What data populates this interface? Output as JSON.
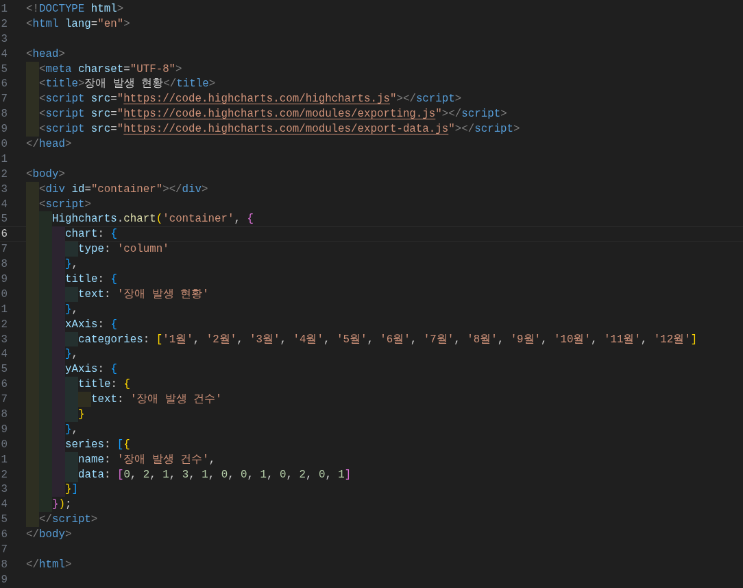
{
  "editor": {
    "lines": [
      {
        "number": "1",
        "current": false,
        "tokens": [
          {
            "kind": "punct",
            "text": "<!"
          },
          {
            "kind": "tag",
            "text": "DOCTYPE"
          },
          {
            "kind": "attr",
            "text": " html"
          },
          {
            "kind": "punct",
            "text": ">"
          }
        ]
      },
      {
        "number": "2",
        "current": false,
        "tokens": [
          {
            "kind": "punct",
            "text": "<"
          },
          {
            "kind": "tag",
            "text": "html"
          },
          {
            "kind": "attr",
            "text": " lang"
          },
          {
            "kind": "text",
            "text": "="
          },
          {
            "kind": "string",
            "text": "\"en\""
          },
          {
            "kind": "punct",
            "text": ">"
          }
        ]
      },
      {
        "number": "3",
        "current": false
      },
      {
        "number": "4",
        "current": false,
        "tokens": [
          {
            "kind": "punct",
            "text": "<"
          },
          {
            "kind": "tag",
            "text": "head"
          },
          {
            "kind": "punct",
            "text": ">"
          }
        ]
      },
      {
        "number": "5",
        "current": false,
        "guides": [
          {
            "color": "#2e2f22"
          }
        ],
        "tokens": [
          {
            "kind": "punct",
            "text": "<"
          },
          {
            "kind": "tag",
            "text": "meta"
          },
          {
            "kind": "attr",
            "text": " charset"
          },
          {
            "kind": "text",
            "text": "="
          },
          {
            "kind": "string",
            "text": "\"UTF-8\""
          },
          {
            "kind": "punct",
            "text": ">"
          }
        ]
      },
      {
        "number": "6",
        "current": false,
        "guides": [
          {
            "color": "#2e2f22"
          }
        ],
        "tokens": [
          {
            "kind": "punct",
            "text": "<"
          },
          {
            "kind": "tag",
            "text": "title"
          },
          {
            "kind": "punct",
            "text": ">"
          },
          {
            "kind": "text",
            "text": "장애 발생 현황"
          },
          {
            "kind": "punct",
            "text": "</"
          },
          {
            "kind": "tag",
            "text": "title"
          },
          {
            "kind": "punct",
            "text": ">"
          }
        ]
      },
      {
        "number": "7",
        "current": false,
        "guides": [
          {
            "color": "#2e2f22"
          }
        ],
        "tokens": [
          {
            "kind": "punct",
            "text": "<"
          },
          {
            "kind": "tag",
            "text": "script"
          },
          {
            "kind": "attr",
            "text": " src"
          },
          {
            "kind": "text",
            "text": "="
          },
          {
            "kind": "string",
            "text": "\""
          },
          {
            "kind": "link",
            "text": "https://code.highcharts.com/highcharts.js"
          },
          {
            "kind": "string",
            "text": "\""
          },
          {
            "kind": "punct",
            "text": "></"
          },
          {
            "kind": "tag",
            "text": "script"
          },
          {
            "kind": "punct",
            "text": ">"
          }
        ]
      },
      {
        "number": "8",
        "current": false,
        "guides": [
          {
            "color": "#2e2f22"
          }
        ],
        "tokens": [
          {
            "kind": "punct",
            "text": "<"
          },
          {
            "kind": "tag",
            "text": "script"
          },
          {
            "kind": "attr",
            "text": " src"
          },
          {
            "kind": "text",
            "text": "="
          },
          {
            "kind": "string",
            "text": "\""
          },
          {
            "kind": "link",
            "text": "https://code.highcharts.com/modules/exporting.js"
          },
          {
            "kind": "string",
            "text": "\""
          },
          {
            "kind": "punct",
            "text": "></"
          },
          {
            "kind": "tag",
            "text": "script"
          },
          {
            "kind": "punct",
            "text": ">"
          }
        ]
      },
      {
        "number": "9",
        "current": false,
        "guides": [
          {
            "color": "#2e2f22"
          }
        ],
        "tokens": [
          {
            "kind": "punct",
            "text": "<"
          },
          {
            "kind": "tag",
            "text": "script"
          },
          {
            "kind": "attr",
            "text": " src"
          },
          {
            "kind": "text",
            "text": "="
          },
          {
            "kind": "string",
            "text": "\""
          },
          {
            "kind": "link",
            "text": "https://code.highcharts.com/modules/export-data.js"
          },
          {
            "kind": "string",
            "text": "\""
          },
          {
            "kind": "punct",
            "text": "></"
          },
          {
            "kind": "tag",
            "text": "script"
          },
          {
            "kind": "punct",
            "text": ">"
          }
        ]
      },
      {
        "number": "0",
        "current": false,
        "tokens": [
          {
            "kind": "punct",
            "text": "</"
          },
          {
            "kind": "tag",
            "text": "head"
          },
          {
            "kind": "punct",
            "text": ">"
          }
        ]
      },
      {
        "number": "1",
        "current": false
      },
      {
        "number": "2",
        "current": false,
        "tokens": [
          {
            "kind": "punct",
            "text": "<"
          },
          {
            "kind": "tag",
            "text": "body"
          },
          {
            "kind": "punct",
            "text": ">"
          }
        ]
      },
      {
        "number": "3",
        "current": false,
        "guides": [
          {
            "color": "#2e2f22"
          }
        ],
        "tokens": [
          {
            "kind": "punct",
            "text": "<"
          },
          {
            "kind": "tag",
            "text": "div"
          },
          {
            "kind": "attr",
            "text": " id"
          },
          {
            "kind": "text",
            "text": "="
          },
          {
            "kind": "string",
            "text": "\"container\""
          },
          {
            "kind": "punct",
            "text": "></"
          },
          {
            "kind": "tag",
            "text": "div"
          },
          {
            "kind": "punct",
            "text": ">"
          }
        ]
      },
      {
        "number": "4",
        "current": false,
        "guides": [
          {
            "color": "#2e2f22"
          }
        ],
        "tokens": [
          {
            "kind": "punct",
            "text": "<"
          },
          {
            "kind": "tag",
            "text": "script"
          },
          {
            "kind": "punct",
            "text": ">"
          }
        ]
      },
      {
        "number": "5",
        "current": false,
        "guides": [
          {
            "color": "#2e2f22"
          },
          {
            "color": "#232d25"
          }
        ],
        "tokens": [
          {
            "kind": "var",
            "text": "Highcharts"
          },
          {
            "kind": "text",
            "text": "."
          },
          {
            "kind": "fn",
            "text": "chart"
          },
          {
            "kind": "bracket1",
            "text": "("
          },
          {
            "kind": "string",
            "text": "'container'"
          },
          {
            "kind": "text",
            "text": ", "
          },
          {
            "kind": "bracket2",
            "text": "{"
          }
        ]
      },
      {
        "number": "6",
        "current": true,
        "guides": [
          {
            "color": "#2e2f22"
          },
          {
            "color": "#232d25"
          },
          {
            "color": "#2c2430"
          }
        ],
        "tokens": [
          {
            "kind": "var",
            "text": "chart"
          },
          {
            "kind": "text",
            "text": ": "
          },
          {
            "kind": "bracket3",
            "text": "{"
          }
        ]
      },
      {
        "number": "7",
        "current": false,
        "guides": [
          {
            "color": "#2e2f22"
          },
          {
            "color": "#232d25"
          },
          {
            "color": "#2c2430"
          },
          {
            "color": "#24302f"
          }
        ],
        "tokens": [
          {
            "kind": "var",
            "text": "type"
          },
          {
            "kind": "text",
            "text": ": "
          },
          {
            "kind": "string",
            "text": "'column'"
          }
        ]
      },
      {
        "number": "8",
        "current": false,
        "guides": [
          {
            "color": "#2e2f22"
          },
          {
            "color": "#232d25"
          },
          {
            "color": "#2c2430"
          }
        ],
        "tokens": [
          {
            "kind": "bracket3",
            "text": "}"
          },
          {
            "kind": "text",
            "text": ","
          }
        ]
      },
      {
        "number": "9",
        "current": false,
        "guides": [
          {
            "color": "#2e2f22"
          },
          {
            "color": "#232d25"
          },
          {
            "color": "#2c2430"
          }
        ],
        "tokens": [
          {
            "kind": "var",
            "text": "title"
          },
          {
            "kind": "text",
            "text": ": "
          },
          {
            "kind": "bracket3",
            "text": "{"
          }
        ]
      },
      {
        "number": "0",
        "current": false,
        "guides": [
          {
            "color": "#2e2f22"
          },
          {
            "color": "#232d25"
          },
          {
            "color": "#2c2430"
          },
          {
            "color": "#24302f"
          }
        ],
        "tokens": [
          {
            "kind": "var",
            "text": "text"
          },
          {
            "kind": "text",
            "text": ": "
          },
          {
            "kind": "string",
            "text": "'장애 발생 현황'"
          }
        ]
      },
      {
        "number": "1",
        "current": false,
        "guides": [
          {
            "color": "#2e2f22"
          },
          {
            "color": "#232d25"
          },
          {
            "color": "#2c2430"
          }
        ],
        "tokens": [
          {
            "kind": "bracket3",
            "text": "}"
          },
          {
            "kind": "text",
            "text": ","
          }
        ]
      },
      {
        "number": "2",
        "current": false,
        "guides": [
          {
            "color": "#2e2f22"
          },
          {
            "color": "#232d25"
          },
          {
            "color": "#2c2430"
          }
        ],
        "tokens": [
          {
            "kind": "var",
            "text": "xAxis"
          },
          {
            "kind": "text",
            "text": ": "
          },
          {
            "kind": "bracket3",
            "text": "{"
          }
        ]
      },
      {
        "number": "3",
        "current": false,
        "guides": [
          {
            "color": "#2e2f22"
          },
          {
            "color": "#232d25"
          },
          {
            "color": "#2c2430"
          },
          {
            "color": "#24302f"
          }
        ],
        "tokens": [
          {
            "kind": "var",
            "text": "categories"
          },
          {
            "kind": "text",
            "text": ": "
          },
          {
            "kind": "bracket1",
            "text": "["
          },
          {
            "kind": "string",
            "text": "'1월'"
          },
          {
            "kind": "text",
            "text": ", "
          },
          {
            "kind": "string",
            "text": "'2월'"
          },
          {
            "kind": "text",
            "text": ", "
          },
          {
            "kind": "string",
            "text": "'3월'"
          },
          {
            "kind": "text",
            "text": ", "
          },
          {
            "kind": "string",
            "text": "'4월'"
          },
          {
            "kind": "text",
            "text": ", "
          },
          {
            "kind": "string",
            "text": "'5월'"
          },
          {
            "kind": "text",
            "text": ", "
          },
          {
            "kind": "string",
            "text": "'6월'"
          },
          {
            "kind": "text",
            "text": ", "
          },
          {
            "kind": "string",
            "text": "'7월'"
          },
          {
            "kind": "text",
            "text": ", "
          },
          {
            "kind": "string",
            "text": "'8월'"
          },
          {
            "kind": "text",
            "text": ", "
          },
          {
            "kind": "string",
            "text": "'9월'"
          },
          {
            "kind": "text",
            "text": ", "
          },
          {
            "kind": "string",
            "text": "'10월'"
          },
          {
            "kind": "text",
            "text": ", "
          },
          {
            "kind": "string",
            "text": "'11월'"
          },
          {
            "kind": "text",
            "text": ", "
          },
          {
            "kind": "string",
            "text": "'12월'"
          },
          {
            "kind": "bracket1",
            "text": "]"
          }
        ]
      },
      {
        "number": "4",
        "current": false,
        "guides": [
          {
            "color": "#2e2f22"
          },
          {
            "color": "#232d25"
          },
          {
            "color": "#2c2430"
          }
        ],
        "tokens": [
          {
            "kind": "bracket3",
            "text": "}"
          },
          {
            "kind": "text",
            "text": ","
          }
        ]
      },
      {
        "number": "5",
        "current": false,
        "guides": [
          {
            "color": "#2e2f22"
          },
          {
            "color": "#232d25"
          },
          {
            "color": "#2c2430"
          }
        ],
        "tokens": [
          {
            "kind": "var",
            "text": "yAxis"
          },
          {
            "kind": "text",
            "text": ": "
          },
          {
            "kind": "bracket3",
            "text": "{"
          }
        ]
      },
      {
        "number": "6",
        "current": false,
        "guides": [
          {
            "color": "#2e2f22"
          },
          {
            "color": "#232d25"
          },
          {
            "color": "#2c2430"
          },
          {
            "color": "#24302f"
          }
        ],
        "tokens": [
          {
            "kind": "var",
            "text": "title"
          },
          {
            "kind": "text",
            "text": ": "
          },
          {
            "kind": "bracket1",
            "text": "{"
          }
        ]
      },
      {
        "number": "7",
        "current": false,
        "guides": [
          {
            "color": "#2e2f22"
          },
          {
            "color": "#232d25"
          },
          {
            "color": "#2c2430"
          },
          {
            "color": "#24302f"
          },
          {
            "color": "#2f2e20"
          }
        ],
        "tokens": [
          {
            "kind": "var",
            "text": "text"
          },
          {
            "kind": "text",
            "text": ": "
          },
          {
            "kind": "string",
            "text": "'장애 발생 건수'"
          }
        ]
      },
      {
        "number": "8",
        "current": false,
        "guides": [
          {
            "color": "#2e2f22"
          },
          {
            "color": "#232d25"
          },
          {
            "color": "#2c2430"
          },
          {
            "color": "#24302f"
          }
        ],
        "tokens": [
          {
            "kind": "bracket1",
            "text": "}"
          }
        ]
      },
      {
        "number": "9",
        "current": false,
        "guides": [
          {
            "color": "#2e2f22"
          },
          {
            "color": "#232d25"
          },
          {
            "color": "#2c2430"
          }
        ],
        "tokens": [
          {
            "kind": "bracket3",
            "text": "}"
          },
          {
            "kind": "text",
            "text": ","
          }
        ]
      },
      {
        "number": "0",
        "current": false,
        "guides": [
          {
            "color": "#2e2f22"
          },
          {
            "color": "#232d25"
          },
          {
            "color": "#2c2430"
          }
        ],
        "tokens": [
          {
            "kind": "var",
            "text": "series"
          },
          {
            "kind": "text",
            "text": ": "
          },
          {
            "kind": "bracket3",
            "text": "["
          },
          {
            "kind": "bracket1",
            "text": "{"
          }
        ]
      },
      {
        "number": "1",
        "current": false,
        "guides": [
          {
            "color": "#2e2f22"
          },
          {
            "color": "#232d25"
          },
          {
            "color": "#2c2430"
          },
          {
            "color": "#24302f"
          }
        ],
        "tokens": [
          {
            "kind": "var",
            "text": "name"
          },
          {
            "kind": "text",
            "text": ": "
          },
          {
            "kind": "string",
            "text": "'장애 발생 건수'"
          },
          {
            "kind": "text",
            "text": ","
          }
        ]
      },
      {
        "number": "2",
        "current": false,
        "guides": [
          {
            "color": "#2e2f22"
          },
          {
            "color": "#232d25"
          },
          {
            "color": "#2c2430"
          },
          {
            "color": "#24302f"
          }
        ],
        "tokens": [
          {
            "kind": "var",
            "text": "data"
          },
          {
            "kind": "text",
            "text": ": "
          },
          {
            "kind": "bracket2",
            "text": "["
          },
          {
            "kind": "number",
            "text": "0"
          },
          {
            "kind": "text",
            "text": ", "
          },
          {
            "kind": "number",
            "text": "2"
          },
          {
            "kind": "text",
            "text": ", "
          },
          {
            "kind": "number",
            "text": "1"
          },
          {
            "kind": "text",
            "text": ", "
          },
          {
            "kind": "number",
            "text": "3"
          },
          {
            "kind": "text",
            "text": ", "
          },
          {
            "kind": "number",
            "text": "1"
          },
          {
            "kind": "text",
            "text": ", "
          },
          {
            "kind": "number",
            "text": "0"
          },
          {
            "kind": "text",
            "text": ", "
          },
          {
            "kind": "number",
            "text": "0"
          },
          {
            "kind": "text",
            "text": ", "
          },
          {
            "kind": "number",
            "text": "1"
          },
          {
            "kind": "text",
            "text": ", "
          },
          {
            "kind": "number",
            "text": "0"
          },
          {
            "kind": "text",
            "text": ", "
          },
          {
            "kind": "number",
            "text": "2"
          },
          {
            "kind": "text",
            "text": ", "
          },
          {
            "kind": "number",
            "text": "0"
          },
          {
            "kind": "text",
            "text": ", "
          },
          {
            "kind": "number",
            "text": "1"
          },
          {
            "kind": "bracket2",
            "text": "]"
          }
        ]
      },
      {
        "number": "3",
        "current": false,
        "guides": [
          {
            "color": "#2e2f22"
          },
          {
            "color": "#232d25"
          },
          {
            "color": "#2c2430"
          }
        ],
        "tokens": [
          {
            "kind": "bracket1",
            "text": "}"
          },
          {
            "kind": "bracket3",
            "text": "]"
          }
        ]
      },
      {
        "number": "4",
        "current": false,
        "guides": [
          {
            "color": "#2e2f22"
          },
          {
            "color": "#232d25"
          }
        ],
        "tokens": [
          {
            "kind": "bracket2",
            "text": "}"
          },
          {
            "kind": "bracket1",
            "text": ")"
          },
          {
            "kind": "text",
            "text": ";"
          }
        ]
      },
      {
        "number": "5",
        "current": false,
        "guides": [
          {
            "color": "#2e2f22"
          }
        ],
        "tokens": [
          {
            "kind": "punct",
            "text": "</"
          },
          {
            "kind": "tag",
            "text": "script"
          },
          {
            "kind": "punct",
            "text": ">"
          }
        ]
      },
      {
        "number": "6",
        "current": false,
        "tokens": [
          {
            "kind": "punct",
            "text": "</"
          },
          {
            "kind": "tag",
            "text": "body"
          },
          {
            "kind": "punct",
            "text": ">"
          }
        ]
      },
      {
        "number": "7",
        "current": false
      },
      {
        "number": "8",
        "current": false,
        "tokens": [
          {
            "kind": "punct",
            "text": "</"
          },
          {
            "kind": "tag",
            "text": "html"
          },
          {
            "kind": "punct",
            "text": ">"
          }
        ]
      },
      {
        "number": "9",
        "current": false
      }
    ]
  }
}
